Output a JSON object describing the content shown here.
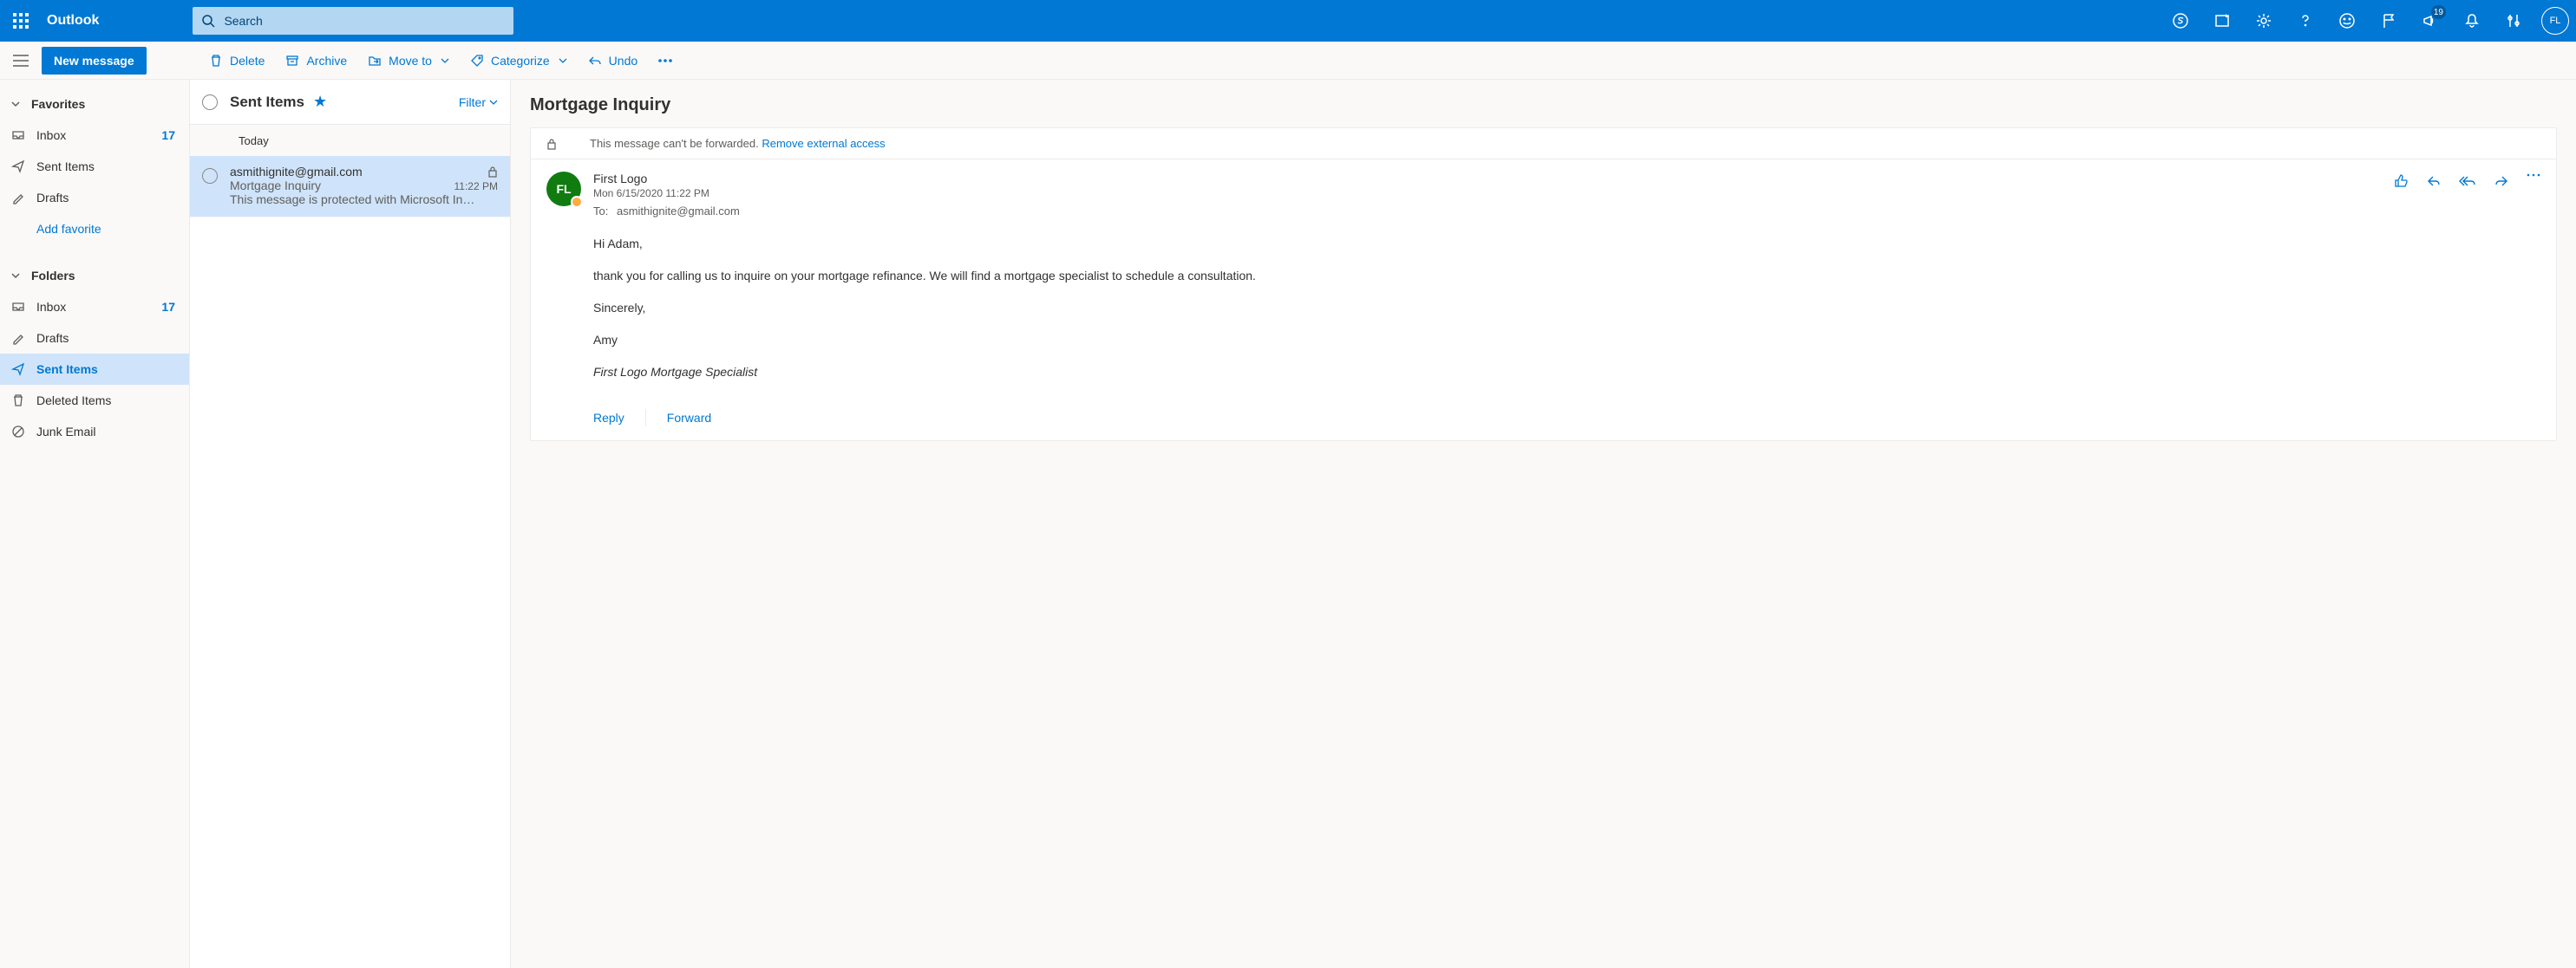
{
  "header": {
    "app_name": "Outlook",
    "search_placeholder": "Search",
    "megaphone_badge": "19",
    "avatar_initials": "FL"
  },
  "subbar": {
    "new_message": "New message",
    "delete": "Delete",
    "archive": "Archive",
    "move_to": "Move to",
    "categorize": "Categorize",
    "undo": "Undo"
  },
  "nav": {
    "favorites": "Favorites",
    "folders": "Folders",
    "add_favorite": "Add favorite",
    "items_fav": [
      {
        "label": "Inbox",
        "count": "17",
        "icon": "inbox"
      },
      {
        "label": "Sent Items",
        "icon": "send"
      },
      {
        "label": "Drafts",
        "icon": "draft"
      }
    ],
    "items_folders": [
      {
        "label": "Inbox",
        "count": "17",
        "icon": "inbox"
      },
      {
        "label": "Drafts",
        "icon": "draft"
      },
      {
        "label": "Sent Items",
        "icon": "send",
        "selected": true
      },
      {
        "label": "Deleted Items",
        "icon": "trash"
      },
      {
        "label": "Junk Email",
        "icon": "junk"
      }
    ]
  },
  "list": {
    "folder": "Sent Items",
    "filter": "Filter",
    "group": "Today",
    "messages": [
      {
        "from": "asmithignite@gmail.com",
        "subject": "Mortgage Inquiry",
        "time": "11:22 PM",
        "preview": "This message is protected with Microsoft In…",
        "locked": true,
        "selected": true
      }
    ]
  },
  "reading": {
    "subject": "Mortgage Inquiry",
    "notice_text": "This message can't be forwarded.",
    "notice_link": "Remove external access",
    "sender_initials": "FL",
    "sender_name": "First Logo",
    "sent_date": "Mon 6/15/2020 11:22 PM",
    "to_label": "To:",
    "to_value": "asmithignite@gmail.com",
    "body_p1": "Hi Adam,",
    "body_p2": " thank you for calling us to inquire on your mortgage refinance.  We will find a mortgage specialist to schedule a consultation.",
    "body_p3": "Sincerely,",
    "body_p4": "Amy",
    "body_sig": "First Logo Mortgage Specialist",
    "reply": "Reply",
    "forward": "Forward"
  }
}
